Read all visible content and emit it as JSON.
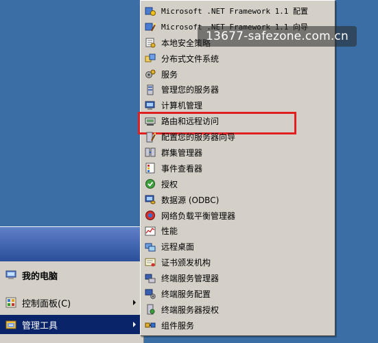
{
  "start_menu": {
    "items": [
      {
        "label": "我的电脑",
        "icon": "my-computer-icon",
        "bold": true
      },
      {
        "label": "控制面板(C)",
        "icon": "control-panel-icon",
        "has_submenu": true
      },
      {
        "label": "管理工具",
        "icon": "admin-tools-icon",
        "has_submenu": true,
        "selected": true
      }
    ]
  },
  "submenu": {
    "items": [
      {
        "label": "Microsoft .NET Framework 1.1 配置",
        "icon": "dotnet-config-icon",
        "mono": true
      },
      {
        "label": "Microsoft .NET Framework 1.1 向导",
        "icon": "dotnet-wizard-icon",
        "mono": true
      },
      {
        "label": "本地安全策略",
        "icon": "local-security-policy-icon"
      },
      {
        "label": "分布式文件系统",
        "icon": "dfs-icon"
      },
      {
        "label": "服务",
        "icon": "services-gear-icon"
      },
      {
        "label": "管理您的服务器",
        "icon": "manage-server-icon"
      },
      {
        "label": "计算机管理",
        "icon": "computer-management-icon"
      },
      {
        "label": "路由和远程访问",
        "icon": "routing-remote-access-icon",
        "highlighted": true
      },
      {
        "label": "配置您的服务器向导",
        "icon": "configure-server-wizard-icon"
      },
      {
        "label": "群集管理器",
        "icon": "cluster-manager-icon"
      },
      {
        "label": "事件查看器",
        "icon": "event-viewer-icon"
      },
      {
        "label": "授权",
        "icon": "licensing-icon"
      },
      {
        "label": "数据源 (ODBC)",
        "icon": "odbc-icon"
      },
      {
        "label": "网络负载平衡管理器",
        "icon": "nlb-manager-icon"
      },
      {
        "label": "性能",
        "icon": "performance-icon"
      },
      {
        "label": "远程桌面",
        "icon": "remote-desktop-icon"
      },
      {
        "label": "证书颁发机构",
        "icon": "certificate-authority-icon"
      },
      {
        "label": "终端服务管理器",
        "icon": "terminal-services-manager-icon"
      },
      {
        "label": "终端服务配置",
        "icon": "terminal-services-config-icon"
      },
      {
        "label": "终端服务器授权",
        "icon": "terminal-server-licensing-icon"
      },
      {
        "label": "组件服务",
        "icon": "component-services-icon"
      }
    ]
  },
  "watermark": {
    "text": "13677-safezone.com.cn"
  },
  "colors": {
    "desktop": "#3a6ea5",
    "menu_bg": "#d4d0c8",
    "selection": "#0a246a",
    "highlight_box": "#e02020"
  }
}
